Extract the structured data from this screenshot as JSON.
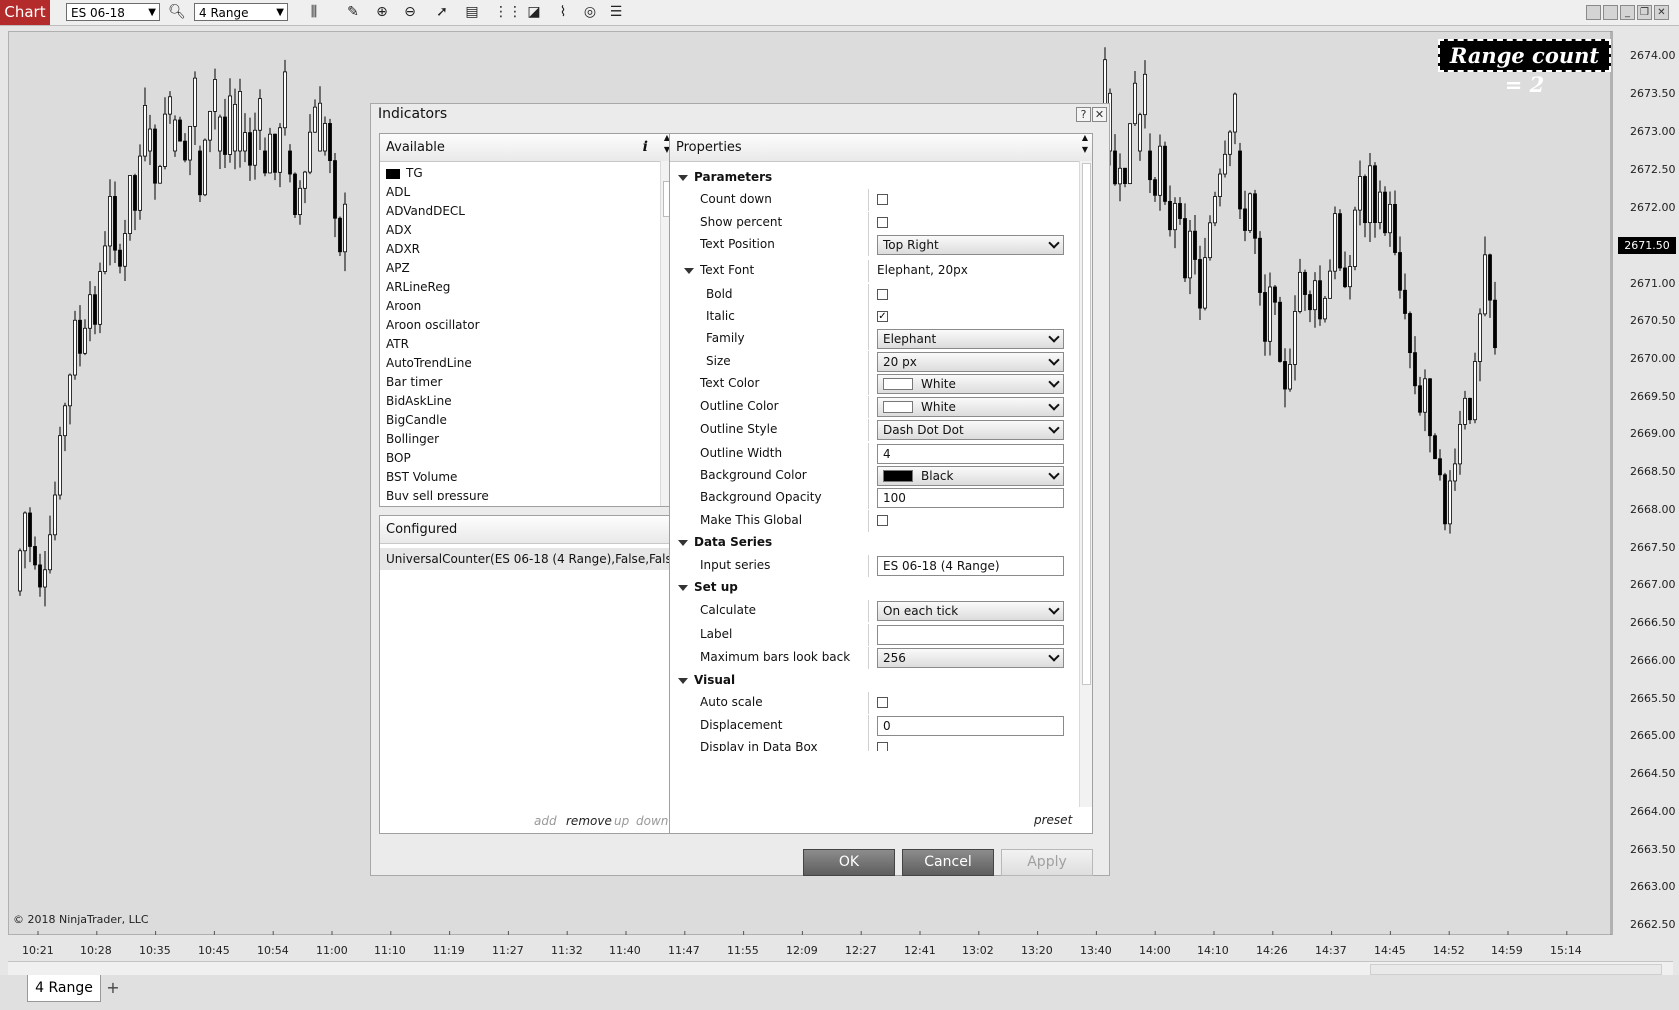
{
  "toolbar": {
    "chart_tab": "Chart",
    "instrument": "ES 06-18",
    "bar_type": "4 Range",
    "icons": [
      "bar-style-icon",
      "draw-pencil-icon",
      "zoom-in-icon",
      "zoom-out-icon",
      "pointer-icon",
      "data-box-icon",
      "strategy-icon",
      "chart-trader-icon",
      "indicators-icon",
      "refresh-icon",
      "properties-icon"
    ]
  },
  "chart": {
    "range_count_label": "Range count = 2",
    "current_price": "2671.50",
    "copyright": "© 2018 NinjaTrader, LLC",
    "price_axis": [
      "2674.00",
      "2673.50",
      "2673.00",
      "2672.50",
      "2672.00",
      "2671.00",
      "2670.50",
      "2670.00",
      "2669.50",
      "2669.00",
      "2668.50",
      "2668.00",
      "2667.50",
      "2667.00",
      "2666.50",
      "2666.00",
      "2665.50",
      "2665.00",
      "2664.50",
      "2664.00",
      "2663.50",
      "2663.00",
      "2662.50"
    ],
    "time_axis": [
      "10:21",
      "10:28",
      "10:35",
      "10:45",
      "10:54",
      "11:00",
      "11:10",
      "11:19",
      "11:27",
      "11:32",
      "11:40",
      "11:47",
      "11:55",
      "12:09",
      "12:27",
      "12:41",
      "13:02",
      "13:20",
      "13:40",
      "14:00",
      "14:10",
      "14:26",
      "14:37",
      "14:45",
      "14:52",
      "14:59",
      "15:14"
    ],
    "tab_label": "4 Range",
    "add_tab": "+"
  },
  "dialog": {
    "title": "Indicators",
    "help": "?",
    "close": "✕",
    "available_header": "Available",
    "info_glyph": "i",
    "available": [
      "TG",
      "ADL",
      "ADVandDECL",
      "ADX",
      "ADXR",
      "APZ",
      "ARLineReg",
      "Aroon",
      "Aroon oscillator",
      "ATR",
      "AutoTrendLine",
      "Bar timer",
      "BidAskLine",
      "BigCandle",
      "Bollinger",
      "BOP",
      "BST Volume",
      "Buy sell pressure"
    ],
    "configured_header": "Configured",
    "configured": [
      "UniversalCounter(ES 06-18 (4 Range),False,Fals..."
    ],
    "links": {
      "add": "add",
      "remove": "remove",
      "up": "up",
      "down": "down"
    },
    "properties_header": "Properties",
    "preset": "preset",
    "categories": {
      "parameters": "Parameters",
      "data_series": "Data Series",
      "setup": "Set up",
      "visual": "Visual"
    },
    "props": {
      "count_down": {
        "label": "Count down",
        "checked": false
      },
      "show_percent": {
        "label": "Show percent",
        "checked": false
      },
      "text_position": {
        "label": "Text Position",
        "value": "Top Right"
      },
      "text_font": {
        "label": "Text Font",
        "value": "Elephant, 20px"
      },
      "bold": {
        "label": "Bold",
        "checked": false
      },
      "italic": {
        "label": "Italic",
        "checked": true
      },
      "family": {
        "label": "Family",
        "value": "Elephant"
      },
      "size": {
        "label": "Size",
        "value": "20 px"
      },
      "text_color": {
        "label": "Text Color",
        "value": "White",
        "color": "#ffffff"
      },
      "outline_color": {
        "label": "Outline Color",
        "value": "White",
        "color": "#ffffff"
      },
      "outline_style": {
        "label": "Outline Style",
        "value": "Dash Dot Dot"
      },
      "outline_width": {
        "label": "Outline Width",
        "value": "4"
      },
      "background_color": {
        "label": "Background Color",
        "value": "Black",
        "color": "#000000"
      },
      "background_opacity": {
        "label": "Background Opacity",
        "value": "100"
      },
      "make_global": {
        "label": "Make This Global",
        "checked": false
      },
      "input_series": {
        "label": "Input series",
        "value": "ES 06-18 (4 Range)"
      },
      "calculate": {
        "label": "Calculate",
        "value": "On each tick"
      },
      "label": {
        "label": "Label",
        "value": ""
      },
      "max_bars": {
        "label": "Maximum bars look back",
        "value": "256"
      },
      "auto_scale": {
        "label": "Auto scale",
        "checked": false
      },
      "displacement": {
        "label": "Displacement",
        "value": "0"
      },
      "display_data_box": {
        "label": "Display in Data Box",
        "checked": false
      }
    },
    "buttons": {
      "ok": "OK",
      "cancel": "Cancel",
      "apply": "Apply"
    }
  },
  "colors": {
    "chart_tab": "#b32b2b",
    "chart_bg": "#dcdcdc",
    "candle": "#000000"
  }
}
